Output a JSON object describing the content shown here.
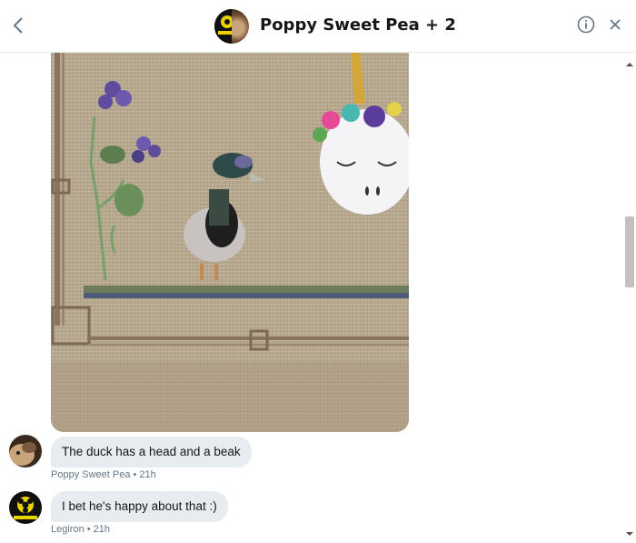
{
  "header": {
    "title": "Poppy Sweet Pea + 2",
    "back_icon": "chevron-left-icon",
    "info_icon": "info-circle-icon",
    "close_icon": "close-icon"
  },
  "messages": [
    {
      "sender": "Poppy Sweet Pea",
      "text": "The duck has a head and a beak",
      "time": "21h",
      "meta": "Poppy Sweet Pea • 21h"
    },
    {
      "sender": "Legiron",
      "text": "I bet he's happy about that :)",
      "time": "21h",
      "meta": "Legiron • 21h"
    }
  ],
  "colors": {
    "bubble": "#e6ecf0",
    "meta_text": "#657786",
    "divider": "#e6ecf0"
  }
}
